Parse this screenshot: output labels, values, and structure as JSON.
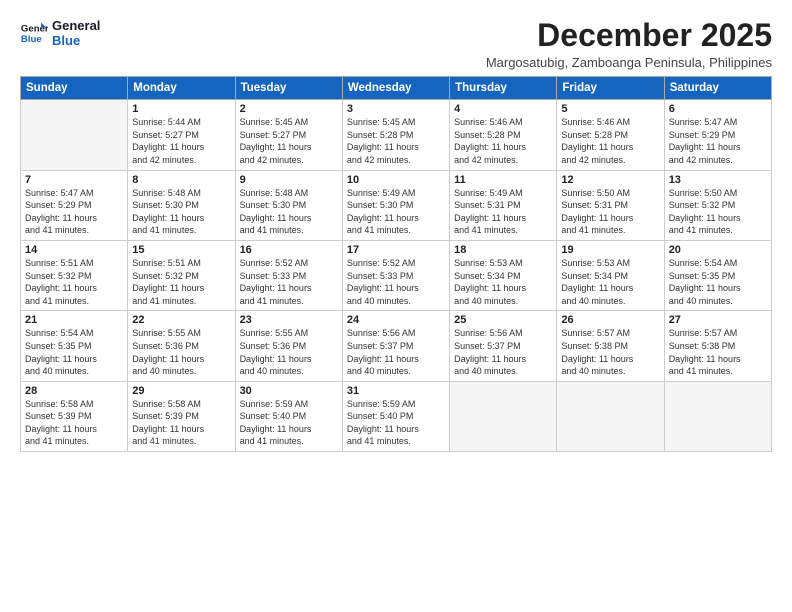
{
  "logo": {
    "line1": "General",
    "line2": "Blue"
  },
  "title": "December 2025",
  "subtitle": "Margosatubig, Zamboanga Peninsula, Philippines",
  "weekdays": [
    "Sunday",
    "Monday",
    "Tuesday",
    "Wednesday",
    "Thursday",
    "Friday",
    "Saturday"
  ],
  "weeks": [
    [
      {
        "day": "",
        "detail": ""
      },
      {
        "day": "1",
        "detail": "Sunrise: 5:44 AM\nSunset: 5:27 PM\nDaylight: 11 hours\nand 42 minutes."
      },
      {
        "day": "2",
        "detail": "Sunrise: 5:45 AM\nSunset: 5:27 PM\nDaylight: 11 hours\nand 42 minutes."
      },
      {
        "day": "3",
        "detail": "Sunrise: 5:45 AM\nSunset: 5:28 PM\nDaylight: 11 hours\nand 42 minutes."
      },
      {
        "day": "4",
        "detail": "Sunrise: 5:46 AM\nSunset: 5:28 PM\nDaylight: 11 hours\nand 42 minutes."
      },
      {
        "day": "5",
        "detail": "Sunrise: 5:46 AM\nSunset: 5:28 PM\nDaylight: 11 hours\nand 42 minutes."
      },
      {
        "day": "6",
        "detail": "Sunrise: 5:47 AM\nSunset: 5:29 PM\nDaylight: 11 hours\nand 42 minutes."
      }
    ],
    [
      {
        "day": "7",
        "detail": "Sunrise: 5:47 AM\nSunset: 5:29 PM\nDaylight: 11 hours\nand 41 minutes."
      },
      {
        "day": "8",
        "detail": "Sunrise: 5:48 AM\nSunset: 5:30 PM\nDaylight: 11 hours\nand 41 minutes."
      },
      {
        "day": "9",
        "detail": "Sunrise: 5:48 AM\nSunset: 5:30 PM\nDaylight: 11 hours\nand 41 minutes."
      },
      {
        "day": "10",
        "detail": "Sunrise: 5:49 AM\nSunset: 5:30 PM\nDaylight: 11 hours\nand 41 minutes."
      },
      {
        "day": "11",
        "detail": "Sunrise: 5:49 AM\nSunset: 5:31 PM\nDaylight: 11 hours\nand 41 minutes."
      },
      {
        "day": "12",
        "detail": "Sunrise: 5:50 AM\nSunset: 5:31 PM\nDaylight: 11 hours\nand 41 minutes."
      },
      {
        "day": "13",
        "detail": "Sunrise: 5:50 AM\nSunset: 5:32 PM\nDaylight: 11 hours\nand 41 minutes."
      }
    ],
    [
      {
        "day": "14",
        "detail": "Sunrise: 5:51 AM\nSunset: 5:32 PM\nDaylight: 11 hours\nand 41 minutes."
      },
      {
        "day": "15",
        "detail": "Sunrise: 5:51 AM\nSunset: 5:32 PM\nDaylight: 11 hours\nand 41 minutes."
      },
      {
        "day": "16",
        "detail": "Sunrise: 5:52 AM\nSunset: 5:33 PM\nDaylight: 11 hours\nand 41 minutes."
      },
      {
        "day": "17",
        "detail": "Sunrise: 5:52 AM\nSunset: 5:33 PM\nDaylight: 11 hours\nand 40 minutes."
      },
      {
        "day": "18",
        "detail": "Sunrise: 5:53 AM\nSunset: 5:34 PM\nDaylight: 11 hours\nand 40 minutes."
      },
      {
        "day": "19",
        "detail": "Sunrise: 5:53 AM\nSunset: 5:34 PM\nDaylight: 11 hours\nand 40 minutes."
      },
      {
        "day": "20",
        "detail": "Sunrise: 5:54 AM\nSunset: 5:35 PM\nDaylight: 11 hours\nand 40 minutes."
      }
    ],
    [
      {
        "day": "21",
        "detail": "Sunrise: 5:54 AM\nSunset: 5:35 PM\nDaylight: 11 hours\nand 40 minutes."
      },
      {
        "day": "22",
        "detail": "Sunrise: 5:55 AM\nSunset: 5:36 PM\nDaylight: 11 hours\nand 40 minutes."
      },
      {
        "day": "23",
        "detail": "Sunrise: 5:55 AM\nSunset: 5:36 PM\nDaylight: 11 hours\nand 40 minutes."
      },
      {
        "day": "24",
        "detail": "Sunrise: 5:56 AM\nSunset: 5:37 PM\nDaylight: 11 hours\nand 40 minutes."
      },
      {
        "day": "25",
        "detail": "Sunrise: 5:56 AM\nSunset: 5:37 PM\nDaylight: 11 hours\nand 40 minutes."
      },
      {
        "day": "26",
        "detail": "Sunrise: 5:57 AM\nSunset: 5:38 PM\nDaylight: 11 hours\nand 40 minutes."
      },
      {
        "day": "27",
        "detail": "Sunrise: 5:57 AM\nSunset: 5:38 PM\nDaylight: 11 hours\nand 41 minutes."
      }
    ],
    [
      {
        "day": "28",
        "detail": "Sunrise: 5:58 AM\nSunset: 5:39 PM\nDaylight: 11 hours\nand 41 minutes."
      },
      {
        "day": "29",
        "detail": "Sunrise: 5:58 AM\nSunset: 5:39 PM\nDaylight: 11 hours\nand 41 minutes."
      },
      {
        "day": "30",
        "detail": "Sunrise: 5:59 AM\nSunset: 5:40 PM\nDaylight: 11 hours\nand 41 minutes."
      },
      {
        "day": "31",
        "detail": "Sunrise: 5:59 AM\nSunset: 5:40 PM\nDaylight: 11 hours\nand 41 minutes."
      },
      {
        "day": "",
        "detail": ""
      },
      {
        "day": "",
        "detail": ""
      },
      {
        "day": "",
        "detail": ""
      }
    ]
  ]
}
